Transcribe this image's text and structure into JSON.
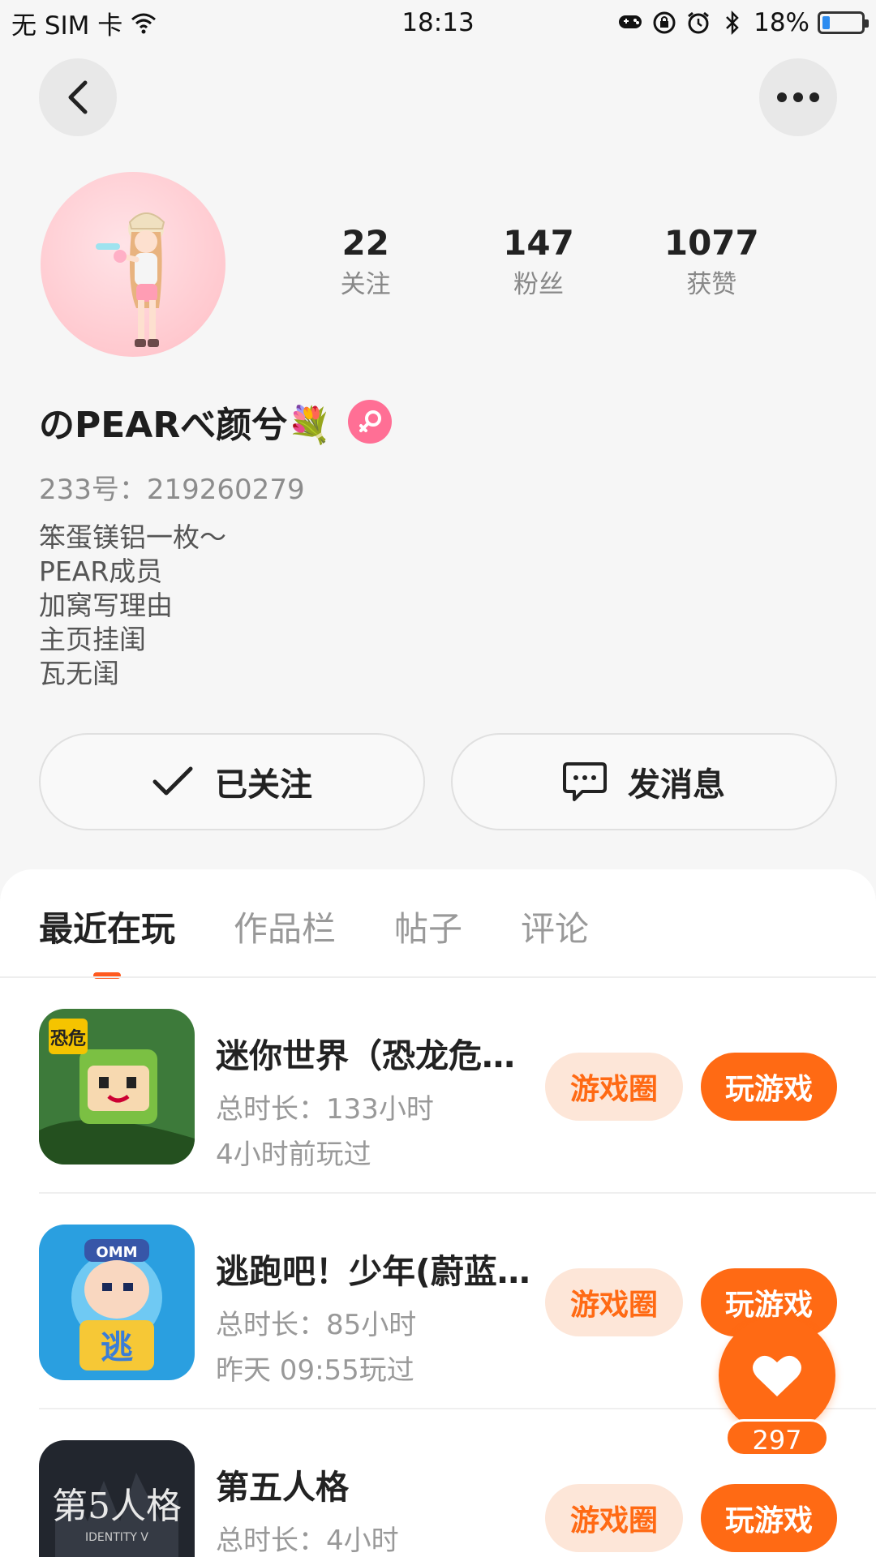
{
  "status_bar": {
    "carrier": "无 SIM 卡",
    "time": "18:13",
    "battery": "18%",
    "battery_level": 0.18
  },
  "profile": {
    "stats": [
      {
        "value": "22",
        "label": "关注"
      },
      {
        "value": "147",
        "label": "粉丝"
      },
      {
        "value": "1077",
        "label": "获赞"
      }
    ],
    "nickname": "のPEARべ颜兮💐",
    "uid": "233号：219260279",
    "bio": [
      "笨蛋镁铝一枚～",
      "PEAR成员",
      "加窝写理由",
      "主页挂闺",
      "瓦无闺"
    ],
    "follow_label": "已关注",
    "message_label": "发消息"
  },
  "tabs": [
    {
      "label": "最近在玩",
      "active": true
    },
    {
      "label": "作品栏",
      "active": false
    },
    {
      "label": "帖子",
      "active": false
    },
    {
      "label": "评论",
      "active": false
    }
  ],
  "games": [
    {
      "title": "迷你世界（恐龙危机）",
      "duration": "总时长：133小时",
      "last_played": "4小时前玩过",
      "circle_label": "游戏圈",
      "play_label": "玩游戏"
    },
    {
      "title": "逃跑吧！少年(蔚蓝之海)",
      "duration": "总时长：85小时",
      "last_played": "昨天 09:55玩过",
      "circle_label": "游戏圈",
      "play_label": "玩游戏"
    },
    {
      "title": "第五人格",
      "duration": "总时长：4小时",
      "last_played": "",
      "circle_label": "游戏圈",
      "play_label": "玩游戏"
    }
  ],
  "like_fab": {
    "count": "297"
  },
  "colors": {
    "accent": "#ff6a14",
    "accent_light": "#fde6d8",
    "gender": "#ff6f95"
  }
}
